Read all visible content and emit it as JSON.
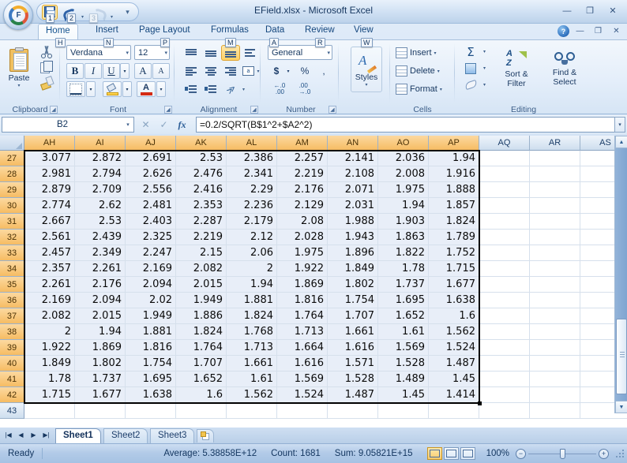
{
  "window": {
    "title": "EField.xlsx - Microsoft Excel",
    "minimize": "—",
    "restore": "❐",
    "close": "✕",
    "app_initial": "F"
  },
  "quick_access": {
    "items": [
      {
        "name": "save",
        "keytip": "1",
        "enabled": true
      },
      {
        "name": "undo",
        "keytip": "2",
        "enabled": true
      },
      {
        "name": "redo",
        "keytip": "3",
        "enabled": false
      }
    ],
    "customize_glyph": "▾"
  },
  "ribbon_window": {
    "help": "?",
    "minimize": "—",
    "restore": "❐",
    "close": "✕"
  },
  "tabs": [
    {
      "label": "Home",
      "keytip": "H",
      "active": true
    },
    {
      "label": "Insert",
      "keytip": "N",
      "active": false
    },
    {
      "label": "Page Layout",
      "keytip": "P",
      "active": false
    },
    {
      "label": "Formulas",
      "keytip": "M",
      "active": false
    },
    {
      "label": "Data",
      "keytip": "A",
      "active": false
    },
    {
      "label": "Review",
      "keytip": "R",
      "active": false
    },
    {
      "label": "View",
      "keytip": "W",
      "active": false
    }
  ],
  "ribbon": {
    "clipboard": {
      "name": "Clipboard",
      "paste": "Paste",
      "paste_arrow": "▾",
      "cut": "Cut",
      "copy": "Copy",
      "format_painter": "Format Painter",
      "launcher": "◢"
    },
    "font": {
      "name": "Font",
      "font_family": "Verdana",
      "font_size": "12",
      "bold": "B",
      "italic": "I",
      "underline": "U",
      "underline_arrow": "▾",
      "grow_font": "A",
      "shrink_font": "A",
      "borders_arrow": "▾",
      "fill_color_arrow": "▾",
      "font_color": "A",
      "font_color_arrow": "▾",
      "launcher": "◢"
    },
    "alignment": {
      "name": "Alignment",
      "align_top": "Top Align",
      "align_middle": "Middle Align",
      "align_bottom": "Bottom Align",
      "wrap_text": "Wrap Text",
      "align_left": "Align Text Left",
      "align_center": "Center",
      "align_right": "Align Text Right",
      "merge_center": "Merge & Center",
      "merge_arrow": "▾",
      "decrease_indent": "Decrease Indent",
      "increase_indent": "Increase Indent",
      "orientation": "Orientation",
      "orientation_arrow": "▾",
      "launcher": "◢"
    },
    "number": {
      "name": "Number",
      "format": "General",
      "format_arrow": "▾",
      "currency": "$",
      "currency_arrow": "▾",
      "percent": "%",
      "comma": ",",
      "increase_decimal": ".00",
      "decrease_decimal": ".00",
      "launcher": "◢"
    },
    "styles": {
      "name": "Styles",
      "label": "Styles",
      "arrow": "▾"
    },
    "cells": {
      "name": "Cells",
      "insert": "Insert",
      "insert_arrow": "▾",
      "delete": "Delete",
      "delete_arrow": "▾",
      "format": "Format",
      "format_arrow": "▾"
    },
    "editing": {
      "name": "Editing",
      "sum": "Σ",
      "sum_arrow": "▾",
      "fill_arrow": "▾",
      "clear_arrow": "▾",
      "sort_filter": "Sort &\nFilter",
      "sort_filter_l1": "Sort &",
      "sort_filter_l2": "Filter",
      "sort_arrow": "▾",
      "find_select_l1": "Find &",
      "find_select_l2": "Select",
      "find_arrow": "▾"
    }
  },
  "formula_bar": {
    "name_box": "B2",
    "name_box_arrow": "▾",
    "cancel": "✕",
    "enter": "✓",
    "insert_function": "fx",
    "formula": "=0.2/SQRT(B$1^2+$A2^2)",
    "expand": "▾"
  },
  "grid": {
    "columns": [
      "AH",
      "AI",
      "AJ",
      "AK",
      "AL",
      "AM",
      "AN",
      "AO",
      "AP",
      "AQ",
      "AR",
      "AS"
    ],
    "selected_columns": [
      "AH",
      "AI",
      "AJ",
      "AK",
      "AL",
      "AM",
      "AN",
      "AO",
      "AP"
    ],
    "rows": [
      "27",
      "28",
      "29",
      "30",
      "31",
      "32",
      "33",
      "34",
      "35",
      "36",
      "37",
      "38",
      "39",
      "40",
      "41",
      "42",
      "43"
    ],
    "selected_rows": [
      "27",
      "28",
      "29",
      "30",
      "31",
      "32",
      "33",
      "34",
      "35",
      "36",
      "37",
      "38",
      "39",
      "40",
      "41",
      "42"
    ],
    "data": [
      [
        "3.077",
        "2.872",
        "2.691",
        "2.53",
        "2.386",
        "2.257",
        "2.141",
        "2.036",
        "1.94"
      ],
      [
        "2.981",
        "2.794",
        "2.626",
        "2.476",
        "2.341",
        "2.219",
        "2.108",
        "2.008",
        "1.916"
      ],
      [
        "2.879",
        "2.709",
        "2.556",
        "2.416",
        "2.29",
        "2.176",
        "2.071",
        "1.975",
        "1.888"
      ],
      [
        "2.774",
        "2.62",
        "2.481",
        "2.353",
        "2.236",
        "2.129",
        "2.031",
        "1.94",
        "1.857"
      ],
      [
        "2.667",
        "2.53",
        "2.403",
        "2.287",
        "2.179",
        "2.08",
        "1.988",
        "1.903",
        "1.824"
      ],
      [
        "2.561",
        "2.439",
        "2.325",
        "2.219",
        "2.12",
        "2.028",
        "1.943",
        "1.863",
        "1.789"
      ],
      [
        "2.457",
        "2.349",
        "2.247",
        "2.15",
        "2.06",
        "1.975",
        "1.896",
        "1.822",
        "1.752"
      ],
      [
        "2.357",
        "2.261",
        "2.169",
        "2.082",
        "2",
        "1.922",
        "1.849",
        "1.78",
        "1.715"
      ],
      [
        "2.261",
        "2.176",
        "2.094",
        "2.015",
        "1.94",
        "1.869",
        "1.802",
        "1.737",
        "1.677"
      ],
      [
        "2.169",
        "2.094",
        "2.02",
        "1.949",
        "1.881",
        "1.816",
        "1.754",
        "1.695",
        "1.638"
      ],
      [
        "2.082",
        "2.015",
        "1.949",
        "1.886",
        "1.824",
        "1.764",
        "1.707",
        "1.652",
        "1.6"
      ],
      [
        "2",
        "1.94",
        "1.881",
        "1.824",
        "1.768",
        "1.713",
        "1.661",
        "1.61",
        "1.562"
      ],
      [
        "1.922",
        "1.869",
        "1.816",
        "1.764",
        "1.713",
        "1.664",
        "1.616",
        "1.569",
        "1.524"
      ],
      [
        "1.849",
        "1.802",
        "1.754",
        "1.707",
        "1.661",
        "1.616",
        "1.571",
        "1.528",
        "1.487"
      ],
      [
        "1.78",
        "1.737",
        "1.695",
        "1.652",
        "1.61",
        "1.569",
        "1.528",
        "1.489",
        "1.45"
      ],
      [
        "1.715",
        "1.677",
        "1.638",
        "1.6",
        "1.562",
        "1.524",
        "1.487",
        "1.45",
        "1.414"
      ]
    ]
  },
  "sheet_tabs": {
    "nav": {
      "first": "|◀",
      "prev": "◀",
      "next": "▶",
      "last": "▶|"
    },
    "sheets": [
      {
        "label": "Sheet1",
        "active": true
      },
      {
        "label": "Sheet2",
        "active": false
      },
      {
        "label": "Sheet3",
        "active": false
      }
    ],
    "new_sheet": "Insert Worksheet"
  },
  "status_bar": {
    "mode": "Ready",
    "average": "Average: 5.38858E+12",
    "count": "Count: 1681",
    "sum": "Sum: 9.05821E+15",
    "views": [
      {
        "name": "normal",
        "active": true
      },
      {
        "name": "page-layout",
        "active": false
      },
      {
        "name": "page-break-preview",
        "active": false
      }
    ],
    "zoom": "100%",
    "zoom_out": "−",
    "zoom_in": "+"
  },
  "colors": {
    "selection_header": "#f6bc63",
    "selection_fill": "#e8eef8",
    "accent": "#2f6bb0"
  }
}
